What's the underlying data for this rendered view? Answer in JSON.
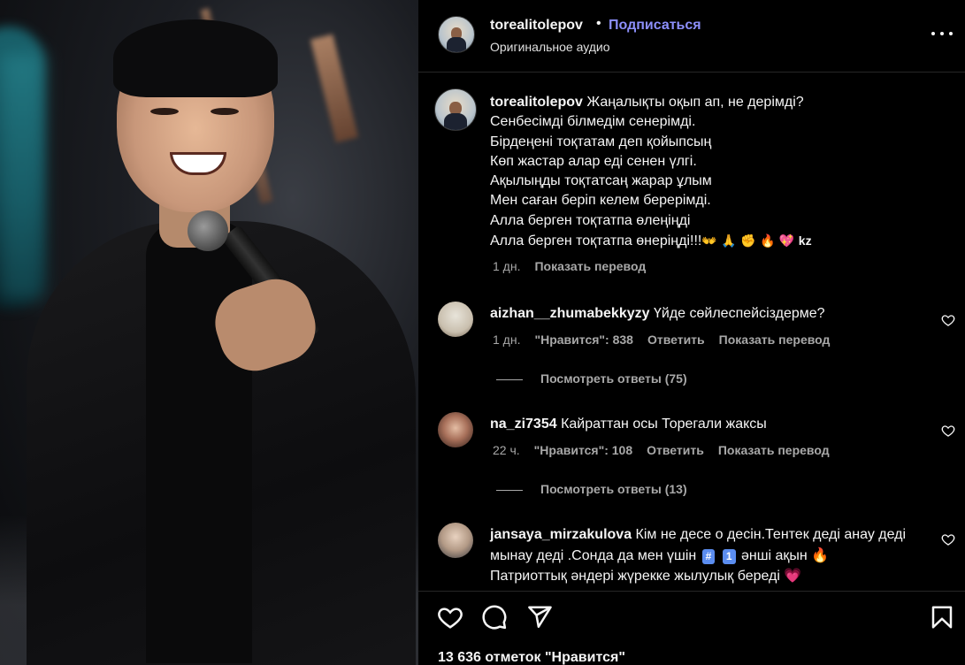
{
  "post": {
    "author": "torealitolepov",
    "separator": "•",
    "follow_label": "Подписаться",
    "audio_label": "Оригинальное аудио",
    "more_icon": "more-horizontal-icon"
  },
  "caption": {
    "username": "torealitolepov",
    "lines": [
      "Жаңалықты оқып ап, не дерімді?",
      "Сенбесімді білмедім сенерімді.",
      "Бірдеңені тоқтатам деп қойыпсың",
      "Көп жастар алар еді сенен үлгі.",
      "Ақылыңды тоқтатсаң жарар ұлым",
      "Мен саған беріп келем берерімді.",
      "Алла берген тоқтатпа өлеңіңді",
      "Алла берген тоқтатпа өнеріңді!!!"
    ],
    "emojis": "👐 🙏 ✊ 🔥 💖",
    "flag": "kz",
    "time": "1 дн.",
    "translate_label": "Показать перевод"
  },
  "comments": [
    {
      "username": "aizhan__zhumabekkyzy",
      "text": "Үйде сөйлеспейсіздерме?",
      "time": "1 дн.",
      "likes": "\"Нравится\": 838",
      "reply_label": "Ответить",
      "translate_label": "Показать перевод",
      "replies_label": "Посмотреть ответы (75)"
    },
    {
      "username": "na_zi7354",
      "text": "Кайраттан осы Торегали жаксы",
      "time": "22 ч.",
      "likes": "\"Нравится\": 108",
      "reply_label": "Ответить",
      "translate_label": "Показать перевод",
      "replies_label": "Посмотреть ответы (13)"
    },
    {
      "username": "jansaya_mirzakulova",
      "text_part1": "Кім не десе о десін.Тентек деді анау деді мынау деді .Сонда да мен үшін",
      "tag1": "#",
      "tag2": "1",
      "text_part2": "әнші ақын 🔥",
      "text_part3": "Патриоттық әндері жүрекке жылулық береді 💗"
    }
  ],
  "actions": {
    "like_icon": "heart-icon",
    "comment_icon": "comment-icon",
    "share_icon": "share-icon",
    "save_icon": "bookmark-icon",
    "likes_count": "13 636 отметок \"Нравится\""
  },
  "colors": {
    "background": "#000000",
    "text": "#f5f5f5",
    "muted": "#a8a8a8",
    "follow": "#8c8ffb",
    "divider": "#262626"
  }
}
